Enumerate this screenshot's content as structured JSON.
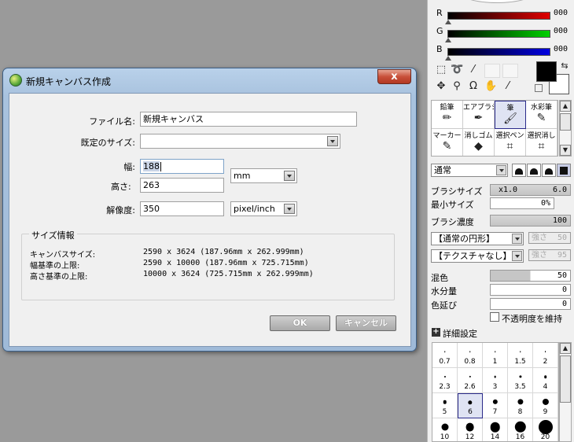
{
  "dialog": {
    "title": "新規キャンバス作成",
    "close_glyph": "x",
    "file_name_label": "ファイル名:",
    "file_name_value": "新規キャンバス",
    "preset_size_label": "既定のサイズ:",
    "preset_size_value": "",
    "width_label": "幅:",
    "width_value": "188",
    "height_label": "高さ:",
    "height_value": "263",
    "unit_value": "mm",
    "resolution_label": "解像度:",
    "resolution_value": "350",
    "resolution_unit_value": "pixel/inch",
    "size_info_title": "サイズ情報",
    "canvas_size_label": "キャンバスサイズ:",
    "canvas_size_value": "2590 x 3624 (187.96mm x 262.999mm)",
    "width_limit_label": "幅基準の上限:",
    "width_limit_value": "2590 x 10000 (187.96mm x 725.715mm)",
    "height_limit_label": "高さ基準の上限:",
    "height_limit_value": "10000 x 3624 (725.715mm x 262.999mm)",
    "ok_label": "OK",
    "cancel_label": "キャンセル"
  },
  "color": {
    "r_label": "R",
    "r_value": "000",
    "g_label": "G",
    "g_value": "000",
    "b_label": "B",
    "b_value": "000",
    "r_color": "#e00000",
    "g_color": "#00d000",
    "b_color": "#0000e0",
    "foreground": "#000000",
    "background": "#ffffff"
  },
  "tools": {
    "icons": [
      "rect-select-icon",
      "lasso-icon",
      "magic-wand-icon",
      "move-icon",
      "zoom-icon",
      "rotate-icon",
      "hand-icon",
      "eyedropper-icon"
    ],
    "brushes": [
      {
        "label": "鉛筆",
        "icon": "pencil-icon"
      },
      {
        "label": "エアブラシ",
        "icon": "airbrush-icon"
      },
      {
        "label": "筆",
        "icon": "brush-icon"
      },
      {
        "label": "水彩筆",
        "icon": "watercolor-icon"
      },
      {
        "label": "マーカー",
        "icon": "marker-icon"
      },
      {
        "label": "消しゴム",
        "icon": "eraser-icon"
      },
      {
        "label": "選択ペン",
        "icon": "select-pen-icon"
      },
      {
        "label": "選択消し",
        "icon": "select-erase-icon"
      }
    ]
  },
  "brush_settings": {
    "blend_mode": "通常",
    "brush_size_label": "ブラシサイズ",
    "brush_size_multiplier": "x1.0",
    "brush_size_value": "6.0",
    "min_size_label": "最小サイズ",
    "min_size_value": "0%",
    "density_label": "ブラシ濃度",
    "density_value": "100",
    "shape_value": "【通常の円形】",
    "shape_strength_label": "強さ",
    "shape_strength_value": "50",
    "texture_value": "【テクスチャなし】",
    "texture_strength_label": "強さ",
    "texture_strength_value": "95",
    "mix_label": "混色",
    "mix_value": "50",
    "water_label": "水分量",
    "water_value": "0",
    "stretch_label": "色延び",
    "stretch_value": "0",
    "keep_opacity_label": "不透明度を維持",
    "detail_label": "詳細設定"
  },
  "size_presets": [
    "0.7",
    "0.8",
    "1",
    "1.5",
    "2",
    "2.3",
    "2.6",
    "3",
    "3.5",
    "4",
    "5",
    "6",
    "7",
    "8",
    "9",
    "10",
    "12",
    "14",
    "16",
    "20"
  ],
  "selected_size": "6"
}
